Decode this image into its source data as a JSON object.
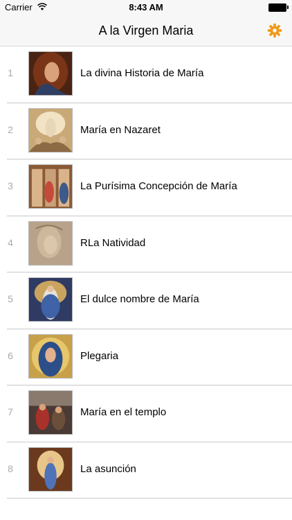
{
  "status_bar": {
    "carrier": "Carrier",
    "time": "8:43 AM"
  },
  "nav": {
    "title": "A la Virgen Maria",
    "settings_icon": "gear-icon",
    "accent": "#f09a1a"
  },
  "items": [
    {
      "number": "1",
      "label": "La divina Historia de María"
    },
    {
      "number": "2",
      "label": "María en Nazaret"
    },
    {
      "number": "3",
      "label": "La Purísima Concepción de María"
    },
    {
      "number": "4",
      "label": "RLa Natividad"
    },
    {
      "number": "5",
      "label": "El dulce nombre de María"
    },
    {
      "number": "6",
      "label": "Plegaria"
    },
    {
      "number": "7",
      "label": "María en el templo"
    },
    {
      "number": "8",
      "label": "La asunción"
    }
  ]
}
